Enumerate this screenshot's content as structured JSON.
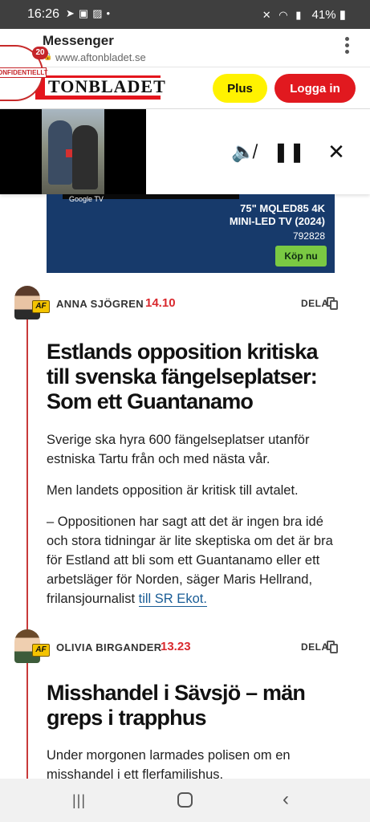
{
  "status_bar": {
    "time": "16:26",
    "notification_icons": [
      "telegram-icon",
      "gallery-icon",
      "image-icon",
      "dot-icon"
    ],
    "battery": "41%"
  },
  "browser": {
    "app_title": "Messenger",
    "url": "www.aftonbladet.se",
    "menu_icon": "more-vert-icon"
  },
  "chathead": {
    "badge_text": "ONFIDENTIELLT",
    "count": "20"
  },
  "site_header": {
    "brand": "TONBLADET",
    "plus_label": "Plus",
    "login_label": "Logga in",
    "brand_color": "#e4151d"
  },
  "video": {
    "overlay_label": "Google TV",
    "controls": [
      "mute-icon",
      "pause-icon",
      "close-icon"
    ]
  },
  "ad": {
    "model": "75\" MQLED85 4K",
    "subtitle": "MINI-LED TV (2024)",
    "sku": "792828",
    "buy_label": "Köp nu"
  },
  "posts": [
    {
      "author": "ANNA SJÖGREN",
      "time": "14.10",
      "share_label": "DELA",
      "headline": "Estlands opposition kritiska till svenska fängelseplatser: Som ett Guantanamo",
      "paragraphs": [
        "Sverige ska hyra 600 fängelseplatser utanför estniska Tartu från och med nästa vår.",
        "Men landets opposition är kritisk till avtalet.",
        "– Oppositionen har sagt att det är ingen bra idé och stora tidningar är lite skeptiska om det är bra för Estland att bli som ett Guantanamo eller ett arbetsläger för Norden, säger Maris Hellrand, frilansjournalist "
      ],
      "link_text": "till SR Ekot."
    },
    {
      "author": "OLIVIA BIRGANDER",
      "time": "13.23",
      "share_label": "DELA",
      "headline": "Misshandel i Sävsjö – män greps i trapphus",
      "paragraphs": [
        "Under morgonen larmades polisen om en misshandel i ett flerfamilishus."
      ]
    }
  ],
  "nav": {
    "recents_icon": "recents-icon",
    "home_icon": "home-icon",
    "back_icon": "back-icon"
  },
  "colors": {
    "accent_red": "#d9292e",
    "plus_yellow": "#fff200",
    "login_red": "#e1191f",
    "link_blue": "#1a5d96"
  }
}
